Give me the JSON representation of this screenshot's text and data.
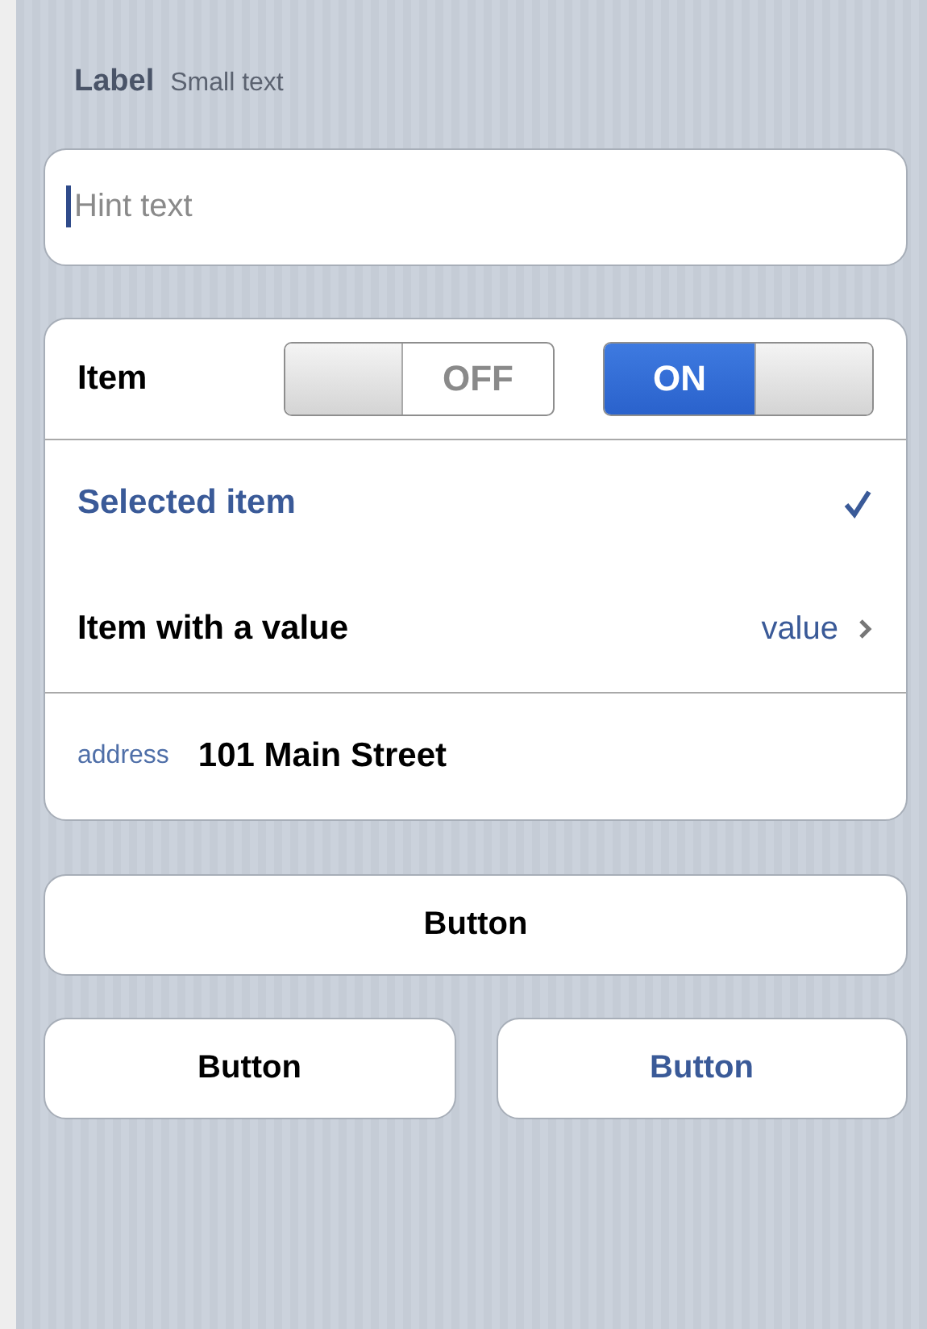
{
  "header": {
    "label": "Label",
    "small_text": "Small text"
  },
  "text_field": {
    "placeholder": "Hint text"
  },
  "rows": [
    {
      "kind": "switches",
      "label": "Item",
      "switches": [
        {
          "label": "OFF",
          "on": false
        },
        {
          "label": "ON",
          "on": true
        }
      ]
    },
    {
      "kind": "check",
      "label": "Selected item",
      "selected": true
    },
    {
      "kind": "value",
      "label": "Item with a value",
      "value": "value"
    },
    {
      "kind": "field",
      "label": "address",
      "value": "101 Main Street"
    }
  ],
  "wide_button": {
    "label": "Button"
  },
  "buttons": [
    {
      "label": "Button",
      "highlighted": false
    },
    {
      "label": "Button",
      "highlighted": true
    }
  ]
}
